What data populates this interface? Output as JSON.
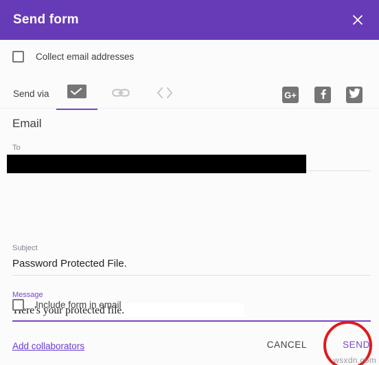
{
  "header": {
    "title": "Send form",
    "close_icon": "close-icon",
    "background_color": "#673ab7"
  },
  "options": {
    "collect_email": {
      "label": "Collect email addresses",
      "checked": false
    },
    "include_form": {
      "label": "Include form in email",
      "checked": false
    }
  },
  "send_via": {
    "label": "Send via",
    "tabs": [
      {
        "name": "email",
        "icon": "envelope-icon",
        "selected": true
      },
      {
        "name": "link",
        "icon": "link-icon",
        "selected": false
      },
      {
        "name": "embed",
        "icon": "embed-code-icon",
        "selected": false
      }
    ],
    "social": [
      {
        "name": "google-plus",
        "glyph": "G+"
      },
      {
        "name": "facebook",
        "glyph": "f"
      },
      {
        "name": "twitter",
        "glyph": "🐦"
      }
    ]
  },
  "email_section": {
    "title": "Email",
    "to": {
      "label": "To",
      "value": "",
      "redacted": true
    },
    "subject": {
      "label": "Subject",
      "value": "Password Protected File."
    },
    "message": {
      "label": "Message",
      "value": "Here's your protected file.",
      "focused": true
    }
  },
  "footer": {
    "add_collaborators": "Add collaborators",
    "cancel": "CANCEL",
    "send": "SEND"
  },
  "annotation": {
    "highlight_target": "send-button",
    "circle_color": "#e01b1b"
  },
  "watermark": "wsxdn.com",
  "colors": {
    "accent_purple": "#7b46c6",
    "header_purple": "#673ab7",
    "link_purple": "#6a3bd6"
  }
}
